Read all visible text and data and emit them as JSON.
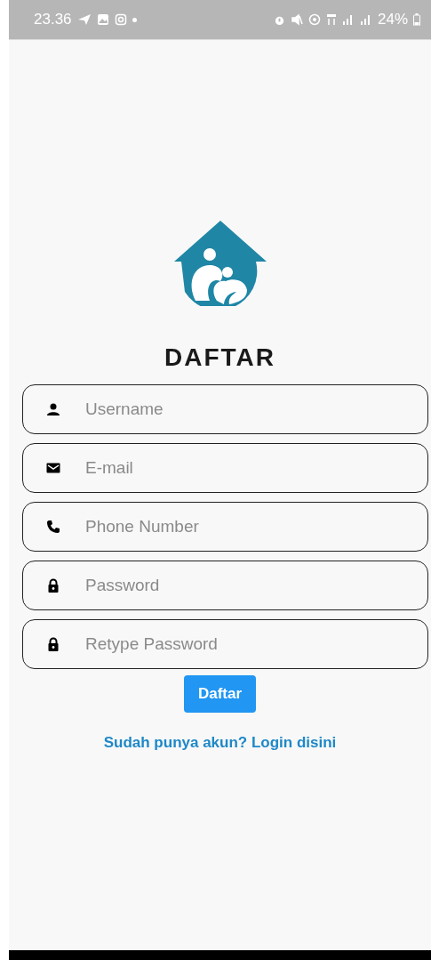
{
  "status_bar": {
    "time": "23.36",
    "battery": "24%"
  },
  "title": "DAFTAR",
  "fields": [
    {
      "kind": "person",
      "placeholder": "Username"
    },
    {
      "kind": "mail",
      "placeholder": "E-mail"
    },
    {
      "kind": "phone",
      "placeholder": "Phone Number"
    },
    {
      "kind": "lock",
      "placeholder": "Password"
    },
    {
      "kind": "lock",
      "placeholder": "Retype Password"
    }
  ],
  "submit_button": "Daftar",
  "login_link": "Sudah punya akun? Login disini"
}
